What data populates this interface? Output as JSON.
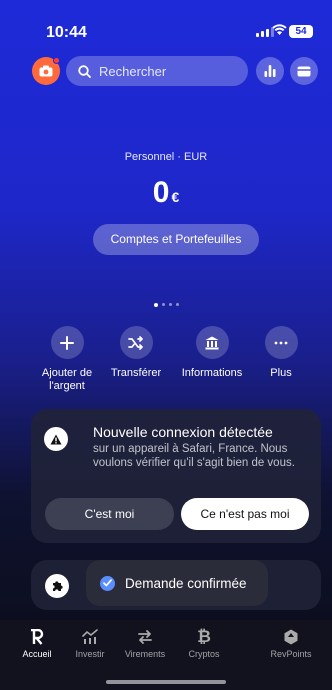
{
  "status_bar": {
    "time": "10:44",
    "battery": "54"
  },
  "search": {
    "placeholder": "Rechercher"
  },
  "account": {
    "label": "Personnel · EUR",
    "amount": "0",
    "currency": "€",
    "button": "Comptes et Portefeuilles"
  },
  "pager": {
    "count": 4,
    "active": 0
  },
  "actions": [
    {
      "label": "Ajouter de l'argent",
      "icon": "plus-icon"
    },
    {
      "label": "Transférer",
      "icon": "shuffle-icon"
    },
    {
      "label": "Informations",
      "icon": "bank-icon"
    },
    {
      "label": "Plus",
      "icon": "more-icon"
    }
  ],
  "alert": {
    "title": "Nouvelle connexion détectée",
    "body": "sur un appareil à Safari, France. Nous voulons vérifier qu'il s'agit bien de vous.",
    "btn_confirm": "C'est moi",
    "btn_deny": "Ce n'est pas moi"
  },
  "toast": {
    "text": "Demande confirmée"
  },
  "tabs": [
    {
      "label": "Accueil",
      "icon": "revolut-r-icon",
      "active": true
    },
    {
      "label": "Investir",
      "icon": "invest-icon"
    },
    {
      "label": "Virements",
      "icon": "transfer-arrows-icon"
    },
    {
      "label": "Cryptos",
      "icon": "bitcoin-icon"
    },
    {
      "label": "RevPoints",
      "icon": "revpoints-icon"
    }
  ],
  "colors": {
    "accent": "#1e2ad8",
    "camera": "#ff6a3d",
    "toast_check": "#5b8dff"
  }
}
